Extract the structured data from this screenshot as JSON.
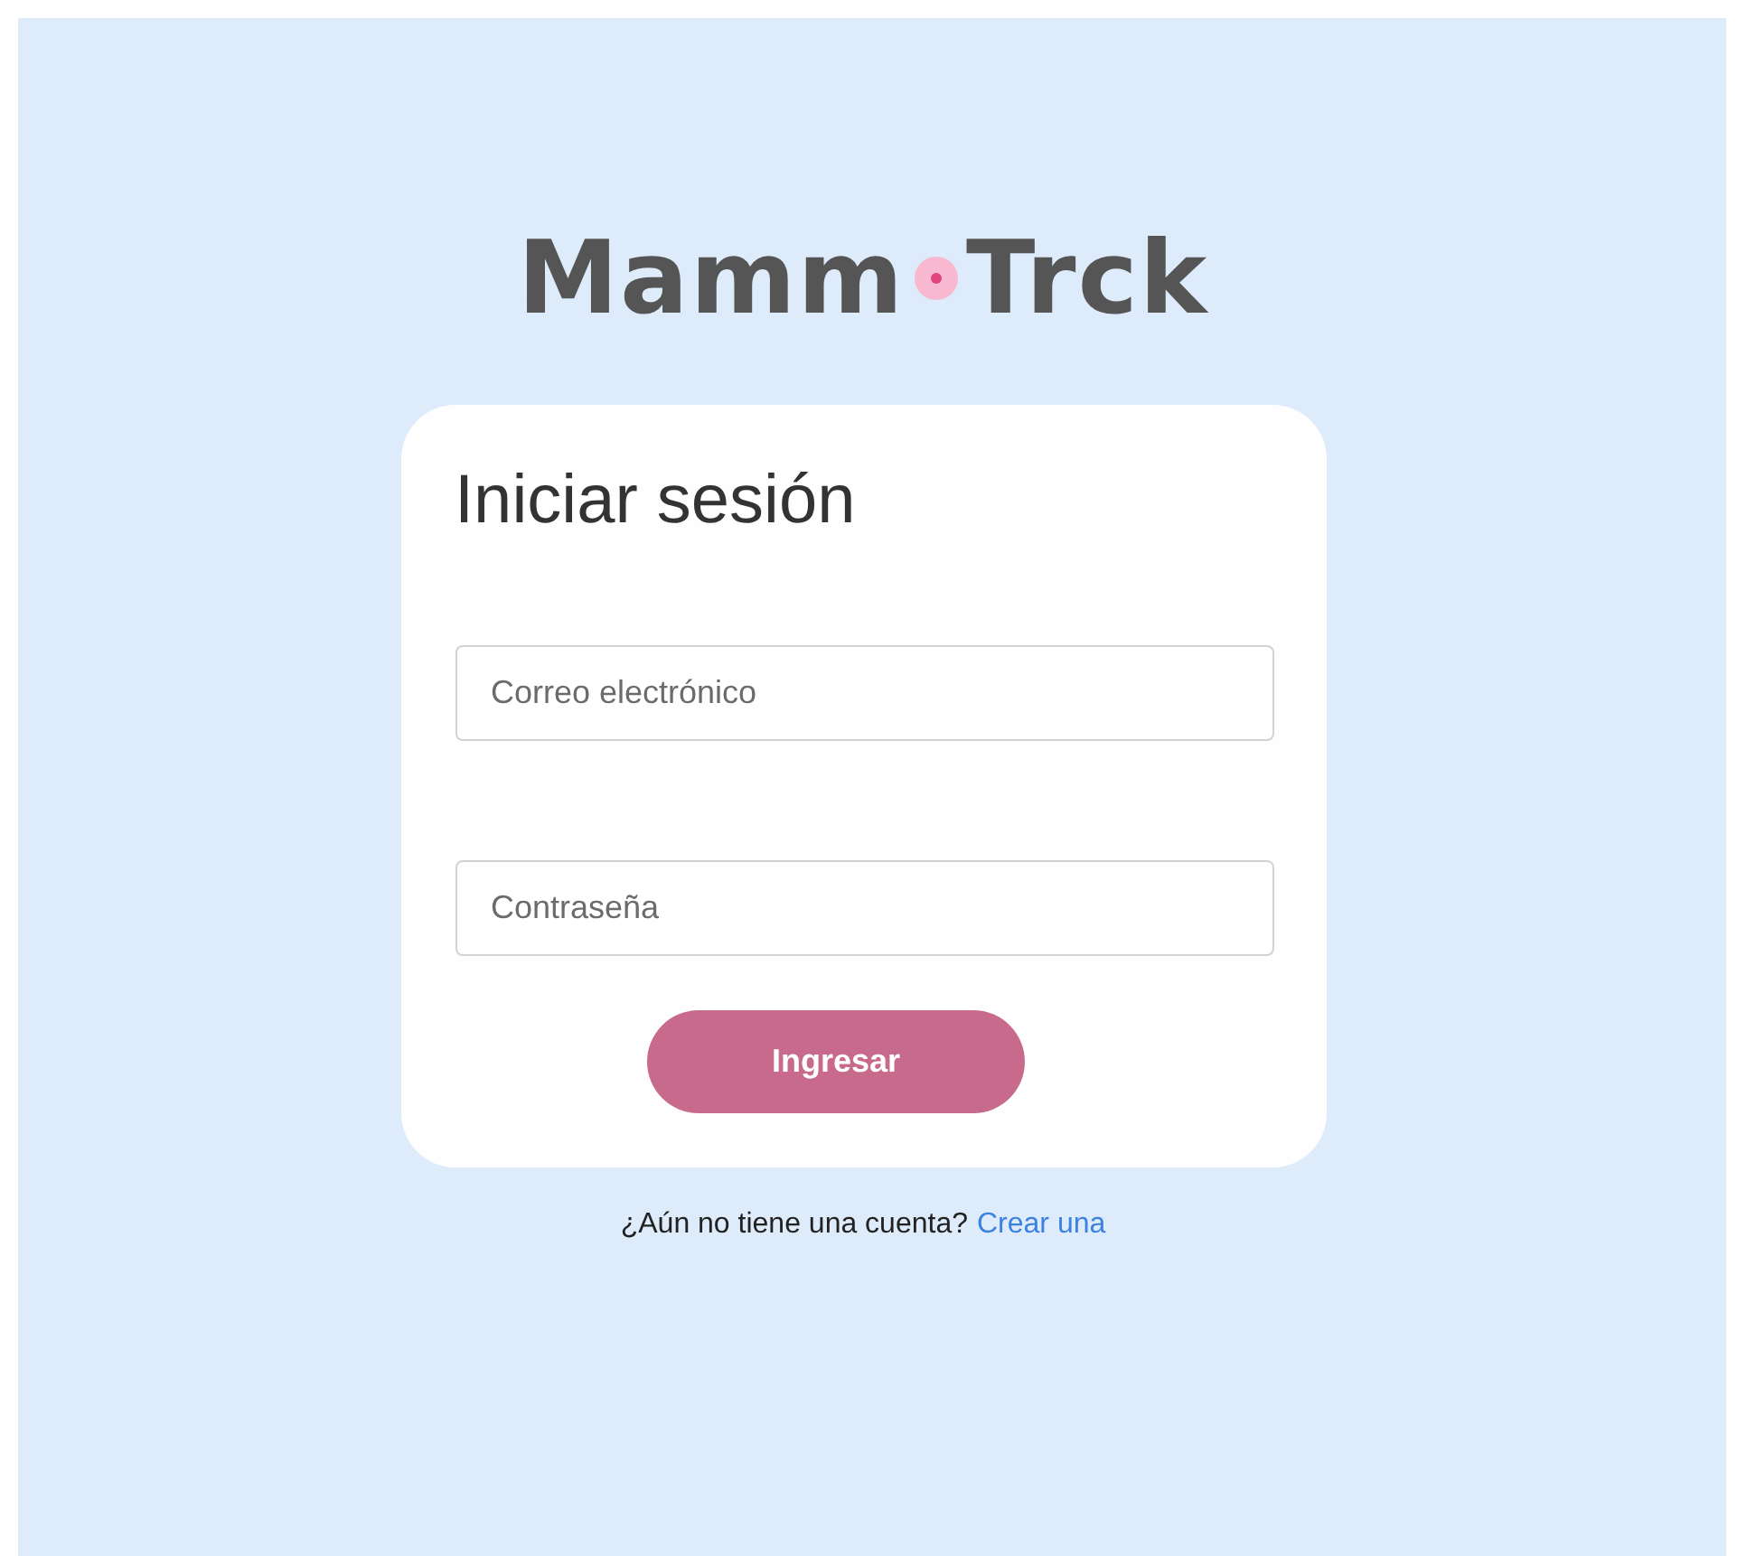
{
  "logo": {
    "part_1": "Mamm",
    "part_2": "Trck"
  },
  "login_card": {
    "title": "Iniciar sesión",
    "fields": [
      {
        "placeholder": "Correo electrónico"
      },
      {
        "placeholder": "Contraseña"
      }
    ],
    "submit_button": "Ingresar"
  },
  "signup_prompt": {
    "text": "¿Aún no tiene una cuenta?",
    "link": "Crear una"
  }
}
